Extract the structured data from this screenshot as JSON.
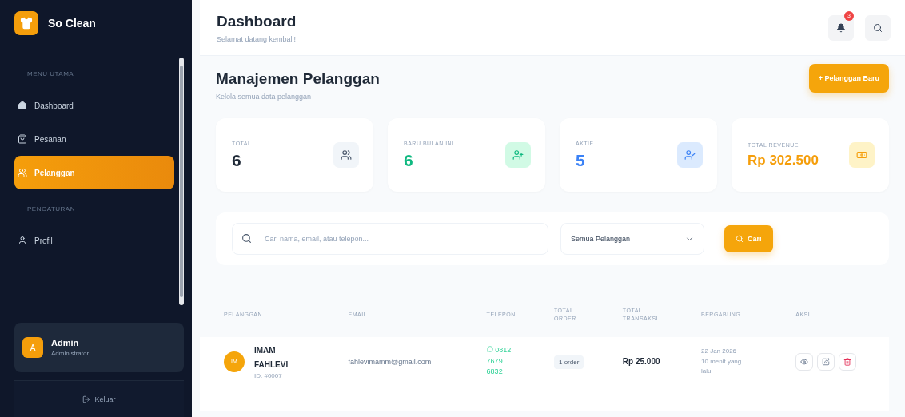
{
  "sidebar": {
    "brand": "So Clean",
    "sections": [
      {
        "title": "MENU UTAMA",
        "items": [
          {
            "label": "Dashboard",
            "kind": "home",
            "selected": false
          },
          {
            "label": "Pesanan",
            "kind": "bag",
            "selected": false
          },
          {
            "label": "Pelanggan",
            "kind": "users",
            "selected": true
          }
        ]
      },
      {
        "title": "PENGATURAN",
        "items": [
          {
            "label": "Profil",
            "kind": "user",
            "selected": false
          }
        ]
      }
    ],
    "user": {
      "initial": "A",
      "name": "Admin",
      "role": "Administrator"
    },
    "logout": "Keluar"
  },
  "header": {
    "title": "Dashboard",
    "subtitle": "Selamat datang kembali!",
    "notification_count": "3"
  },
  "page": {
    "title": "Manajemen Pelanggan",
    "subtitle": "Kelola semua data pelanggan",
    "new_button": "+ Pelanggan Baru"
  },
  "stats": [
    {
      "label": "TOTAL",
      "value": "6",
      "kind": "users",
      "color": "#1f2937"
    },
    {
      "label": "BARU BULAN INI",
      "value": "6",
      "kind": "user-plus",
      "color": "#10b981"
    },
    {
      "label": "AKTIF",
      "value": "5",
      "kind": "user-check",
      "color": "#3b82f6"
    },
    {
      "label": "TOTAL REVENUE",
      "value": "Rp 302.500",
      "kind": "money",
      "color": "#f59e0b"
    }
  ],
  "filter": {
    "placeholder": "Cari nama, email, atau telepon...",
    "select": "Semua Pelanggan",
    "button": "Cari"
  },
  "table": {
    "columns": [
      "PELANGGAN",
      "EMAIL",
      "TELEPON",
      "TOTAL ORDER",
      "TOTAL TRANSAKSI",
      "BERGABUNG",
      "AKSI"
    ],
    "rows": [
      {
        "initials": "IM",
        "name": "IMAM FAHLEVI",
        "id": "ID: #0007",
        "email": "fahlevimamm@gmail.com",
        "phone": "0812 7679 6832",
        "orders": "1 order",
        "transactions": "Rp 25.000",
        "joined": "22 Jan 2026",
        "joined_ago": "10 menit yang lalu"
      }
    ]
  }
}
